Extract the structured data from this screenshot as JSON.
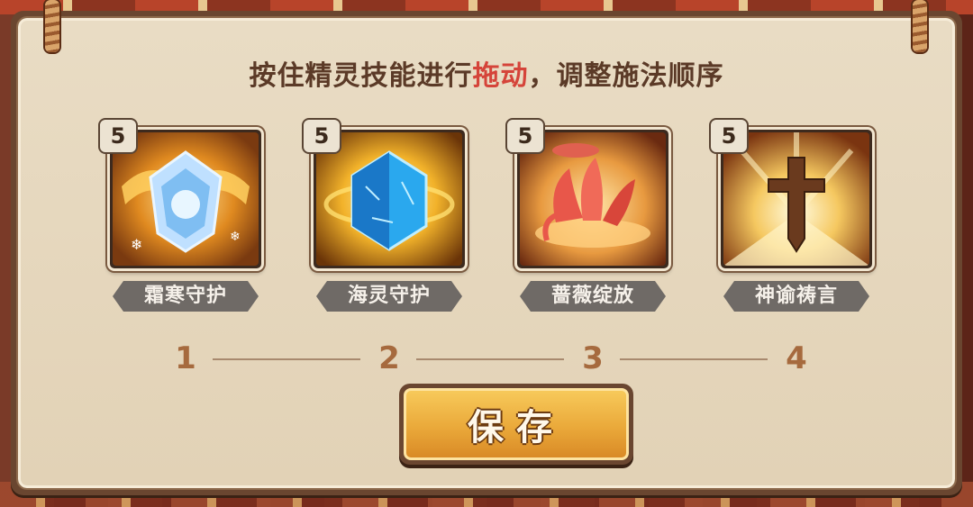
{
  "dialog": {
    "instruction_before": "按住精灵技能进行",
    "instruction_highlight": "拖动",
    "instruction_after": "，调整施法顺序",
    "highlight_color": "#d5443a"
  },
  "skills": [
    {
      "level": "5",
      "name": "霜寒守护",
      "icon": "frost-shield-icon"
    },
    {
      "level": "5",
      "name": "海灵守护",
      "icon": "sea-crystal-icon"
    },
    {
      "level": "5",
      "name": "蔷薇绽放",
      "icon": "rose-bloom-icon"
    },
    {
      "level": "5",
      "name": "神谕祷言",
      "icon": "holy-cross-icon"
    }
  ],
  "order": [
    "1",
    "2",
    "3",
    "4"
  ],
  "buttons": {
    "save_label": "保存"
  }
}
